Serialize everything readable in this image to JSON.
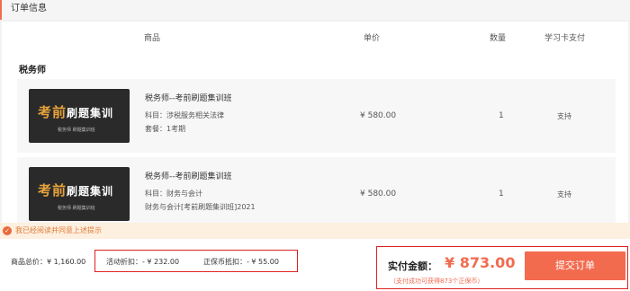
{
  "section": {
    "title": "订单信息"
  },
  "table": {
    "headers": {
      "product": "商品",
      "price": "单价",
      "qty": "数量",
      "card": "学习卡支付"
    },
    "group": "税务师",
    "rows": [
      {
        "thumb_big": "考前",
        "thumb_rest": "刷题集训",
        "thumb_sub": "税务师 刷题集训班",
        "name": "税务师--考前刷题集训班",
        "subject": "科目：涉税服务相关法律",
        "package": "套餐：1考期",
        "price": "¥ 580.00",
        "qty": "1",
        "card": "支持"
      },
      {
        "thumb_big": "考前",
        "thumb_rest": "刷题集训",
        "thumb_sub": "税务师 刷题集训班",
        "name": "税务师--考前刷题集训班",
        "subject": "科目：财务与会计",
        "package": "财务与会计[考前刷题集训班]2021",
        "price": "¥ 580.00",
        "qty": "1",
        "card": "支持"
      }
    ]
  },
  "notice": {
    "text": "我已经阅读并同意上述提示",
    "check_icon": "check-circle-icon"
  },
  "footer": {
    "total": "商品总价：¥ 1,160.00",
    "activity_discount": "活动折扣：- ¥ 232.00",
    "coin_discount": "正保币抵扣：- ¥ 55.00",
    "pay_label": "实付金额：",
    "pay_amount": "¥ 873.00",
    "pay_note": "（支付成功可获得873个正保币）",
    "submit": "提交订单"
  },
  "colors": {
    "accent": "#f26b4f",
    "highlight_border": "#e02020",
    "notice_bg": "#fdf0e0"
  }
}
